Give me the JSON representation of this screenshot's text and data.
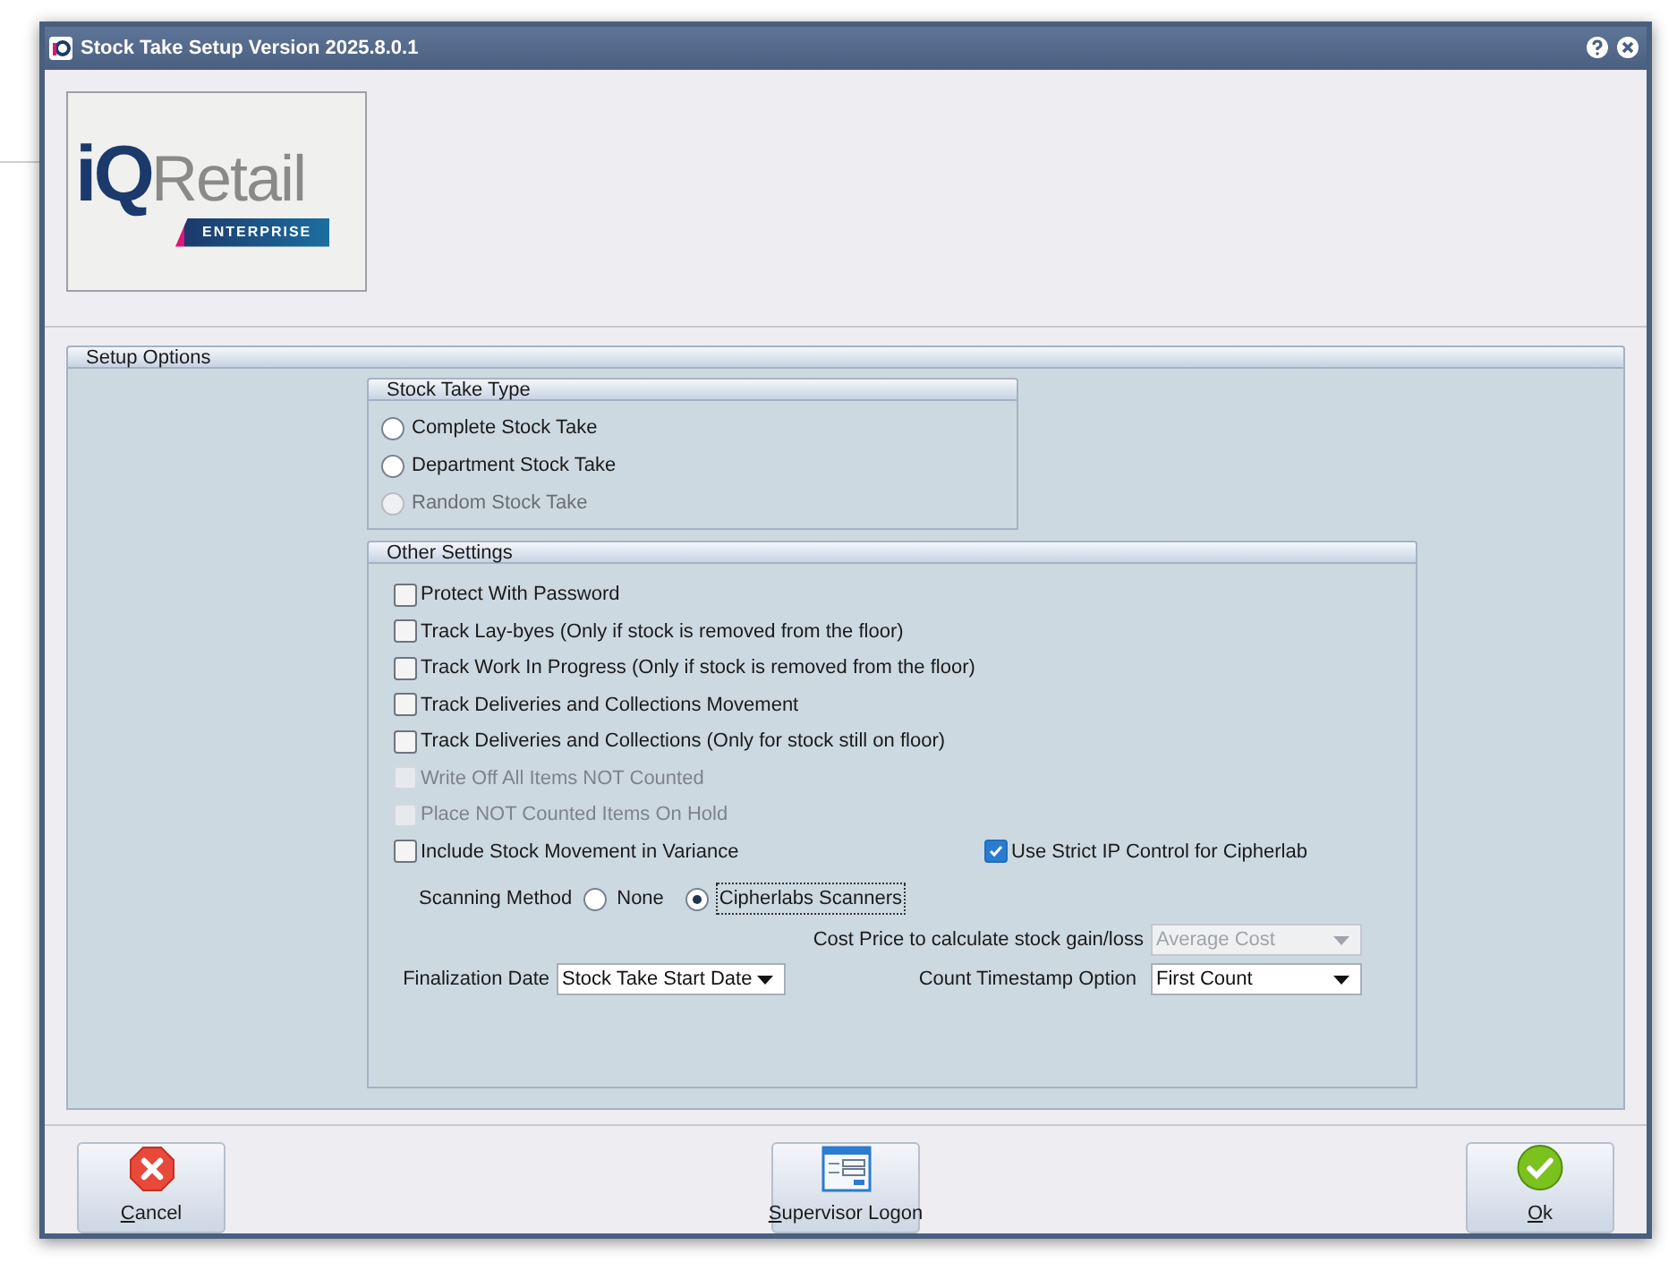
{
  "window": {
    "title": "Stock Take Setup Version 2025.8.0.1"
  },
  "logo": {
    "brand": "iQ",
    "word": "Retail",
    "edition": "ENTERPRISE"
  },
  "setup_options": {
    "title": "Setup Options"
  },
  "stock_take_type": {
    "title": "Stock Take Type",
    "options": [
      {
        "label": "Complete Stock Take",
        "selected": false,
        "disabled": false
      },
      {
        "label": "Department Stock Take",
        "selected": false,
        "disabled": false
      },
      {
        "label": "Random Stock Take",
        "selected": false,
        "disabled": true
      }
    ]
  },
  "other_settings": {
    "title": "Other Settings",
    "checkboxes": [
      {
        "label": "Protect With Password",
        "checked": false,
        "disabled": false
      },
      {
        "label": "Track Lay-byes (Only if stock is removed from the floor)",
        "checked": false,
        "disabled": false
      },
      {
        "label": "Track Work In Progress (Only if stock is removed from the floor)",
        "checked": false,
        "disabled": false
      },
      {
        "label": "Track Deliveries and Collections Movement",
        "checked": false,
        "disabled": false
      },
      {
        "label": "Track Deliveries and Collections (Only for stock still on floor)",
        "checked": false,
        "disabled": false
      },
      {
        "label": "Write Off All Items NOT Counted",
        "checked": false,
        "disabled": true
      },
      {
        "label": "Place NOT Counted Items On Hold",
        "checked": false,
        "disabled": true
      },
      {
        "label": "Include Stock Movement in Variance",
        "checked": false,
        "disabled": false
      }
    ],
    "strict_ip": {
      "label": "Use Strict IP Control for Cipherlab",
      "checked": true
    },
    "scanning_method": {
      "label": "Scanning Method",
      "options": [
        {
          "label": "None",
          "selected": false
        },
        {
          "label": "Cipherlabs Scanners",
          "selected": true
        }
      ]
    },
    "cost_price": {
      "label": "Cost Price to calculate stock gain/loss",
      "value": "Average Cost",
      "disabled": true
    },
    "finalization_date": {
      "label": "Finalization Date",
      "value": "Stock Take Start Date"
    },
    "count_timestamp": {
      "label": "Count Timestamp Option",
      "value": "First Count"
    }
  },
  "buttons": [
    {
      "kind": "cancel",
      "label": "Cancel"
    },
    {
      "kind": "logon",
      "label": "Supervisor Logon"
    },
    {
      "kind": "ok",
      "label": "Ok"
    }
  ]
}
